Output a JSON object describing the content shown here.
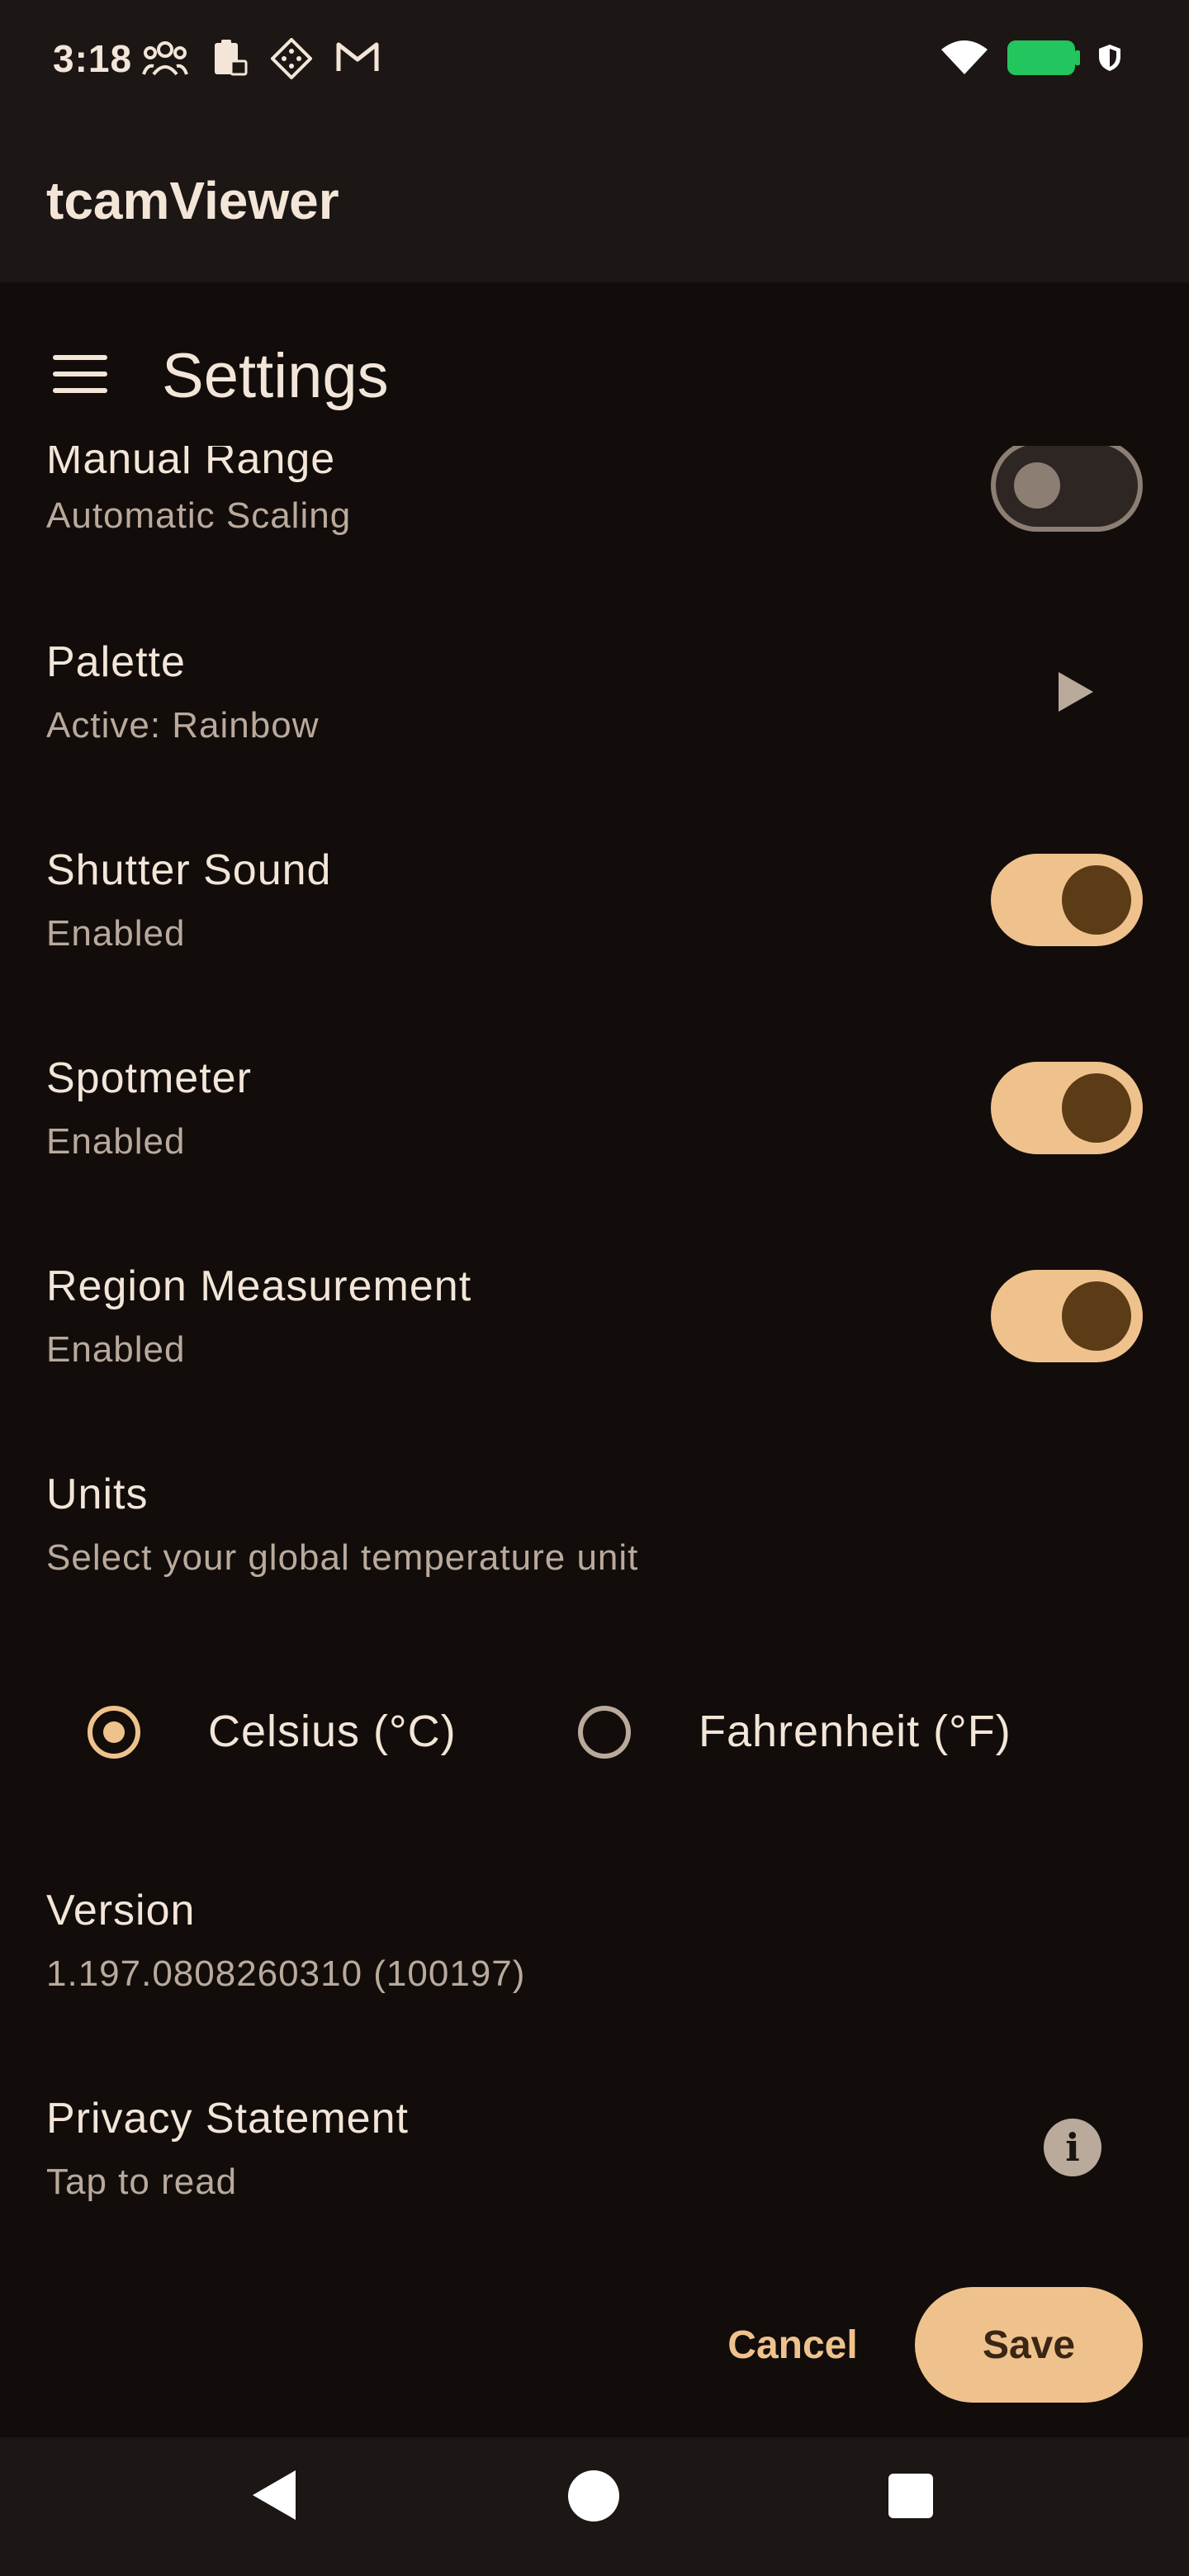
{
  "status_bar": {
    "time": "3:18",
    "icons_left": [
      "people-icon",
      "clipboard-lock-icon",
      "diamond-grid-icon",
      "gmail-icon"
    ],
    "icons_right": [
      "wifi-icon",
      "battery-icon",
      "shield-icon"
    ],
    "battery_color": "#22c55e"
  },
  "app_bar": {
    "title": "tcamViewer"
  },
  "header": {
    "title": "Settings"
  },
  "settings": {
    "manual_range": {
      "title": "Manual Range",
      "subtitle": "Automatic Scaling",
      "enabled": false
    },
    "palette": {
      "title": "Palette",
      "subtitle": "Active: Rainbow"
    },
    "shutter_sound": {
      "title": "Shutter Sound",
      "subtitle": "Enabled",
      "enabled": true
    },
    "spotmeter": {
      "title": "Spotmeter",
      "subtitle": "Enabled",
      "enabled": true
    },
    "region_measurement": {
      "title": "Region Measurement",
      "subtitle": "Enabled",
      "enabled": true
    },
    "units": {
      "title": "Units",
      "subtitle": "Select your global temperature unit",
      "options": [
        {
          "label": "Celsius (°C)",
          "selected": true
        },
        {
          "label": "Fahrenheit (°F)",
          "selected": false
        }
      ]
    },
    "version": {
      "title": "Version",
      "value": "1.197.0808260310 (100197)"
    },
    "privacy": {
      "title": "Privacy Statement",
      "subtitle": "Tap to read"
    }
  },
  "actions": {
    "cancel_label": "Cancel",
    "save_label": "Save"
  },
  "colors": {
    "accent": "#efc28d",
    "background": "#120d0b",
    "bar": "#1c1614",
    "text_primary": "#f3e6d8",
    "text_secondary": "#b9aa9c"
  }
}
